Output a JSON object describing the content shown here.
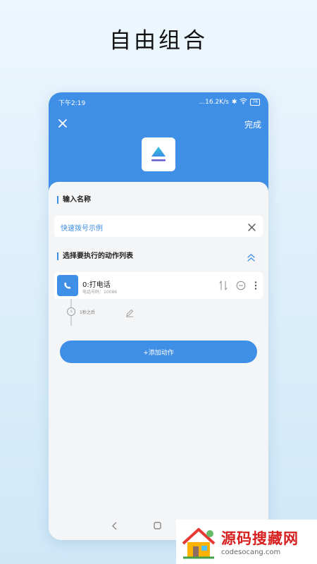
{
  "headline": "自由组合",
  "status_bar": {
    "time": "下午2:19",
    "network": "...16.2K/s",
    "battery": "76"
  },
  "topbar": {
    "done_label": "完成"
  },
  "name_section": {
    "title": "输入名称",
    "value": "快速拨号示例"
  },
  "action_section": {
    "title": "选择要执行的动作列表",
    "actions": [
      {
        "title": "0:打电话",
        "subtitle": "电话号码：10086",
        "delay": "1秒之后"
      }
    ],
    "add_label": "+添加动作"
  },
  "watermark": {
    "name": "源码搜藏网",
    "url": "codesocang.com"
  },
  "colors": {
    "accent": "#3f8fe6",
    "watermark_red": "#d61f1f"
  }
}
